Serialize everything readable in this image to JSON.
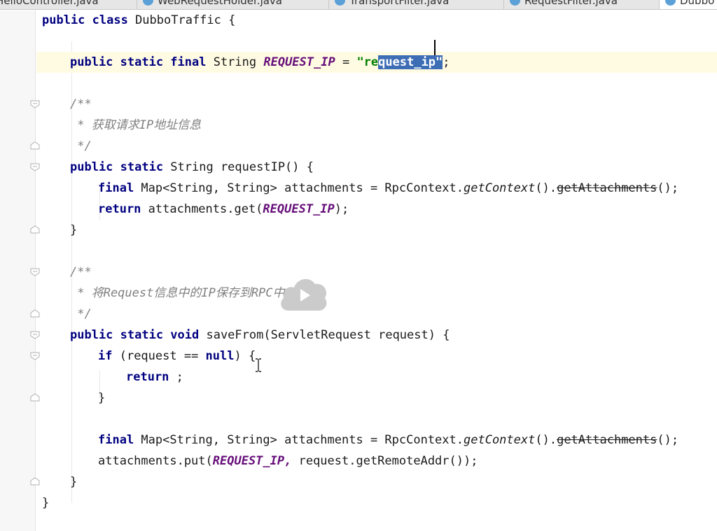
{
  "tabs": [
    {
      "label": "HelloController.java"
    },
    {
      "label": "WebRequestHolder.java"
    },
    {
      "label": "TransportFilter.java"
    },
    {
      "label": "RequestFilter.java"
    },
    {
      "label": "DubboTraffic.java"
    }
  ],
  "code": {
    "class_decl": {
      "kw": "public class",
      "name": " DubboTraffic {"
    },
    "field": {
      "kw": "public static final",
      "type": " String ",
      "const": "REQUEST_IP",
      "eq": " = ",
      "str_open": "\"re",
      "str_sel": "quest_ip\"",
      "semi": ";"
    },
    "doc1": {
      "open": "/**",
      "text": " * 获取请求IP地址信息",
      "close": " */"
    },
    "method1": {
      "sig_kw": "public static",
      "sig": " String requestIP() {",
      "l1_kw": "final",
      "l1_a": " Map<String, String> attachments = RpcContext.",
      "l1_it": "getContext",
      "l1_b": "().",
      "l1_strike": "getAttachments",
      "l1_c": "();",
      "l2_kw": "return",
      "l2_a": " attachments.get(",
      "l2_const": "REQUEST_IP",
      "l2_b": ");",
      "close": "}"
    },
    "doc2": {
      "open": "/**",
      "text": " * 将Request信息中的IP保存到RPC中",
      "close": " */"
    },
    "method2": {
      "sig_kw": "public static void",
      "sig": " saveFrom(ServletRequest request) {",
      "if_kw": "if",
      "if_a": " (request == ",
      "if_null": "null",
      "if_b": ") {",
      "ret_kw": "return",
      "ret_b": " ;",
      "if_close": "}",
      "l1_kw": "final",
      "l1_a": " Map<String, String> attachments = RpcContext.",
      "l1_it": "getContext",
      "l1_b": "().",
      "l1_strike": "getAttachments",
      "l1_c": "();",
      "l2_a": "attachments.put(",
      "l2_const": "REQUEST_IP,",
      "l2_b": " request.getRemoteAddr());",
      "close": "}"
    },
    "class_close": "}"
  },
  "colors": {
    "keyword": "#000080",
    "comment": "#808080",
    "constant": "#660e7a",
    "string": "#008000",
    "selection": "#3d6db5",
    "current_line": "#fffbe3"
  },
  "icons": [
    "java-file-icon",
    "fold-marker-icon",
    "text-cursor-icon",
    "play-overlay-icon"
  ]
}
